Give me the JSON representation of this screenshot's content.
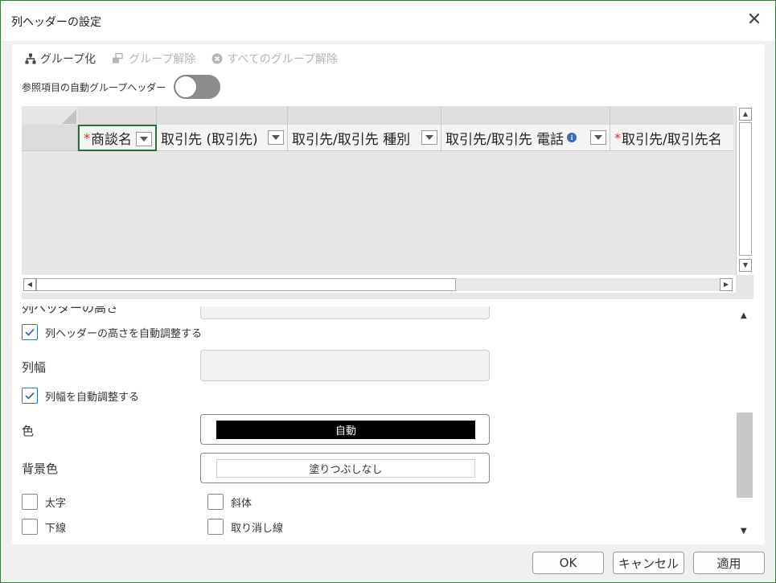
{
  "window": {
    "title": "列ヘッダーの設定",
    "close_symbol": "✕"
  },
  "toolbar": {
    "group_label": "グループ化",
    "ungroup_label": "グループ解除",
    "ungroup_all_label": "すべてのグループ解除"
  },
  "auto_group": {
    "label": "参照項目の自動グループヘッダー",
    "enabled": false
  },
  "grid": {
    "columns": [
      {
        "label": "商談名",
        "required": true,
        "info": false,
        "selected": true
      },
      {
        "label": "取引先 (取引先)",
        "required": false,
        "info": false,
        "selected": false
      },
      {
        "label": "取引先/取引先 種別",
        "required": false,
        "info": false,
        "selected": false
      },
      {
        "label": "取引先/取引先 電話",
        "required": false,
        "info": true,
        "selected": false
      },
      {
        "label": "取引先/取引先名",
        "required": true,
        "info": false,
        "selected": false
      }
    ],
    "required_mark": "*",
    "info_mark": "i"
  },
  "settings": {
    "header_height_label": "列ヘッダーの高さ",
    "auto_height_label": "列ヘッダーの高さを自動調整する",
    "auto_height_checked": true,
    "column_width_label": "列幅",
    "auto_width_label": "列幅を自動調整する",
    "auto_width_checked": true,
    "color_label": "色",
    "color_value": "自動",
    "color_hex": "#000000",
    "color_text_hex": "#ffffff",
    "bg_color_label": "背景色",
    "bg_color_value": "塗りつぶしなし",
    "bold_label": "太字",
    "italic_label": "斜体",
    "underline_label": "下線",
    "strikethrough_label": "取り消し線"
  },
  "footer": {
    "ok_label": "OK",
    "cancel_label": "キャンセル",
    "apply_label": "適用"
  }
}
